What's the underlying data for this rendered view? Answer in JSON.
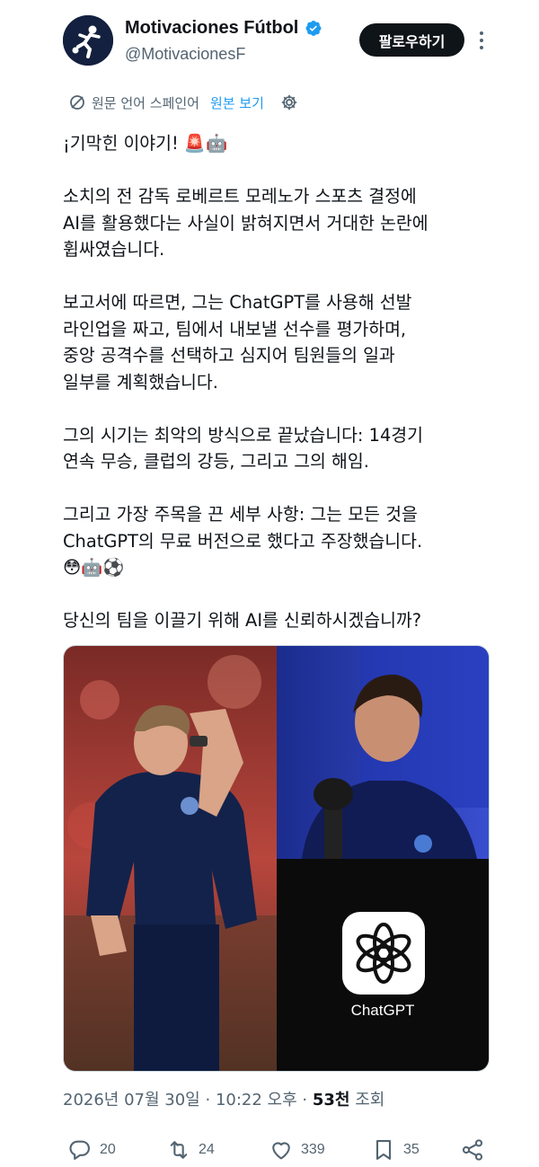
{
  "author": {
    "display_name": "Motivaciones Fútbol",
    "handle": "@MotivacionesF",
    "verified": true,
    "avatar_icon": "football-player-kick-icon"
  },
  "follow_label": "팔로우하기",
  "translation": {
    "source_text": "원문 언어 스페인어",
    "link_text": "원본 보기"
  },
  "tweet": {
    "paragraphs": [
      "¡기막힌 이야기! 🚨🤖",
      "소치의 전 감독 로베르트 모레노가 스포츠 결정에\nAI를 활용했다는 사실이 밝혀지면서 거대한 논란에\n휩싸였습니다.",
      "보고서에 따르면, 그는 ChatGPT를 사용해 선발\n라인업을 짜고, 팀에서 내보낼 선수를 평가하며,\n중앙 공격수를 선택하고 심지어 팀원들의 일과\n일부를 계획했습니다.",
      "그의 시기는 최악의 방식으로 끝났습니다: 14경기\n연속 무승, 클럽의 강등, 그리고 그의 해임.",
      "그리고 가장 주목을 끈 세부 사항: 그는 모든 것을\nChatGPT의 무료 버전으로 했다고 주장했습니다.\n😳🤖⚽",
      "당신의 팀을 이끌기 위해 AI를 신뢰하시겠습니까?"
    ]
  },
  "media": {
    "logo_caption": "ChatGPT"
  },
  "meta": {
    "date": "2026년 07월 30일",
    "time": "10:22 오후",
    "views_count": "53천",
    "views_label": "조회"
  },
  "actions": {
    "replies": "20",
    "reposts": "24",
    "likes": "339",
    "bookmarks": "35"
  },
  "colors": {
    "accent": "#1d9bf0",
    "text_primary": "#0f1419",
    "text_secondary": "#536471",
    "follow_bg": "#0f1419"
  }
}
